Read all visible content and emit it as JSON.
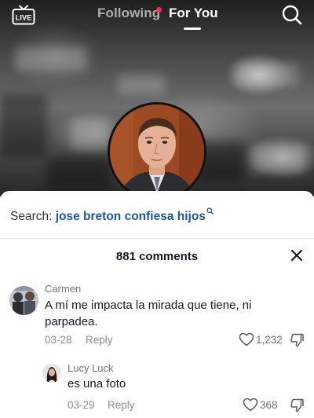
{
  "top_bar": {
    "live_label": "LIVE",
    "tabs": [
      {
        "label": "Following",
        "active": false,
        "has_notification_dot": true
      },
      {
        "label": "For You",
        "active": true
      }
    ],
    "search_icon": "search-icon"
  },
  "colors": {
    "notification_dot": "#fe2c55",
    "search_query": "#1f56a8",
    "text_primary": "#161823",
    "text_secondary": "#8a8b91"
  },
  "search": {
    "prefix": "Search:",
    "query": "jose breton confiesa hijos"
  },
  "comments": {
    "header": "881 comments",
    "items": [
      {
        "user": "Carmen",
        "text": "A mí me impacta la mirada que tiene, ni parpadea.",
        "date": "03-28",
        "reply_label": "Reply",
        "likes": "1,232"
      },
      {
        "user": "Lucy Luck",
        "text": "es una foto",
        "date": "03-29",
        "reply_label": "Reply",
        "likes": "368"
      }
    ]
  }
}
